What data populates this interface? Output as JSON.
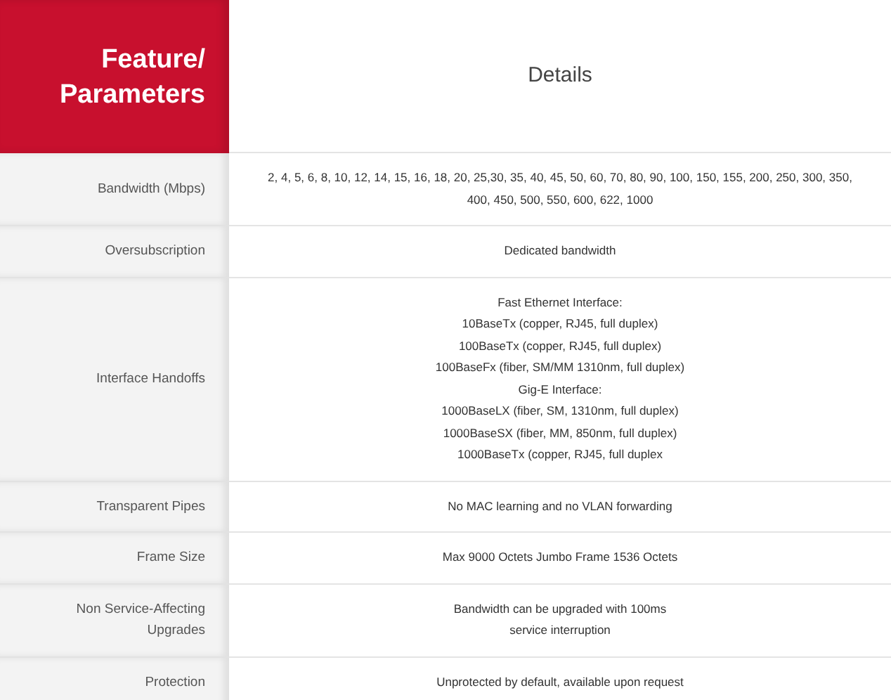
{
  "header": {
    "feature": [
      "Feature/",
      "Parameters"
    ],
    "details": "Details"
  },
  "rows": [
    {
      "label": [
        "Bandwidth (Mbps)"
      ],
      "lines": [
        "2, 4, 5, 6, 8, 10, 12, 14, 15, 16, 18, 20, 25,30, 35, 40, 45, 50, 60, 70, 80, 90, 100, 150, 155, 200, 250, 300, 350,",
        "400, 450, 500, 550, 600, 622, 1000"
      ]
    },
    {
      "label": [
        "Oversubscription"
      ],
      "lines": [
        "Dedicated bandwidth"
      ]
    },
    {
      "label": [
        "Interface Handoffs"
      ],
      "lines": [
        "Fast Ethernet Interface:",
        "10BaseTx (copper, RJ45, full duplex)",
        "100BaseTx (copper, RJ45, full duplex)",
        "100BaseFx (fiber, SM/MM 1310nm, full duplex)",
        "Gig-E Interface:",
        "1000BaseLX (fiber, SM, 1310nm, full duplex)",
        "1000BaseSX (fiber, MM, 850nm, full duplex)",
        "1000BaseTx (copper, RJ45, full duplex"
      ]
    },
    {
      "label": [
        "Transparent Pipes"
      ],
      "lines": [
        "No MAC learning and no VLAN forwarding"
      ]
    },
    {
      "label": [
        "Frame Size"
      ],
      "lines": [
        "Max 9000 Octets Jumbo Frame 1536 Octets"
      ]
    },
    {
      "label": [
        "Non Service-Affecting",
        "Upgrades"
      ],
      "lines": [
        "Bandwidth can be upgraded with 100ms",
        "service interruption"
      ]
    },
    {
      "label": [
        "Protection"
      ],
      "lines": [
        "Unprotected by default, available upon request"
      ]
    }
  ]
}
